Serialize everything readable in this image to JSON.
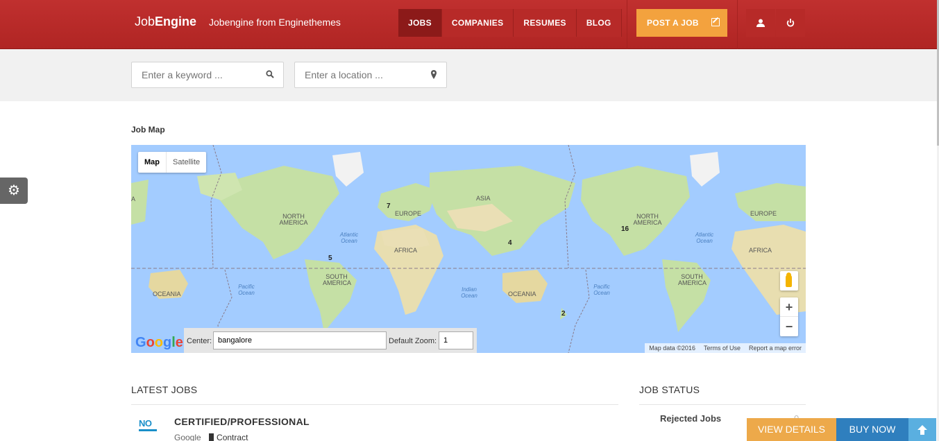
{
  "header": {
    "brand_light": "Job",
    "brand_bold": "Engine",
    "tagline": "Jobengine from Enginethemes",
    "nav": [
      "JOBS",
      "COMPANIES",
      "RESUMES",
      "BLOG"
    ],
    "post_job": "POST A JOB",
    "icons": [
      "user-icon",
      "power-icon"
    ]
  },
  "search": {
    "keyword_placeholder": "Enter a keyword ...",
    "location_placeholder": "Enter a location ..."
  },
  "map_section": {
    "title": "Job Map",
    "map_type_tabs": [
      "Map",
      "Satellite"
    ],
    "continents": [
      "NORTH AMERICA",
      "EUROPE",
      "ASIA",
      "AFRICA",
      "SOUTH AMERICA",
      "OCEANIA",
      "NORTH AMERICA",
      "EUROPE",
      "AFRICA",
      "SOUTH AMERICA",
      "OCEANIA",
      "A"
    ],
    "oceans": [
      "Atlantic Ocean",
      "Pacific Ocean",
      "Indian Ocean",
      "Pacific Ocean",
      "Atlantic Ocean"
    ],
    "clusters": [
      "7",
      "16",
      "4",
      "5",
      "2"
    ],
    "center_label": "Center:",
    "center_value": "bangalore",
    "zoom_label": "Default Zoom:",
    "zoom_value": "1",
    "footer": [
      "Map data ©2016",
      "Terms of Use",
      "Report a map error"
    ],
    "google_logo": "Google"
  },
  "latest_jobs": {
    "title": "LATEST JOBS",
    "jobs": [
      {
        "title": "CERTIFIED/PROFESSIONAL",
        "company": "Google",
        "type": "Contract",
        "logo": "NO"
      }
    ]
  },
  "job_status": {
    "title": "JOB STATUS",
    "rows": [
      {
        "label": "Rejected Jobs",
        "count": "0"
      }
    ]
  },
  "footer_bar": {
    "view_details": "VIEW DETAILS",
    "buy_now": "BUY NOW"
  },
  "colors": {
    "header_red": "#b72a28",
    "post_job": "#f3a23e",
    "view_details": "#eda94a",
    "buy_now": "#2f7fbe"
  }
}
